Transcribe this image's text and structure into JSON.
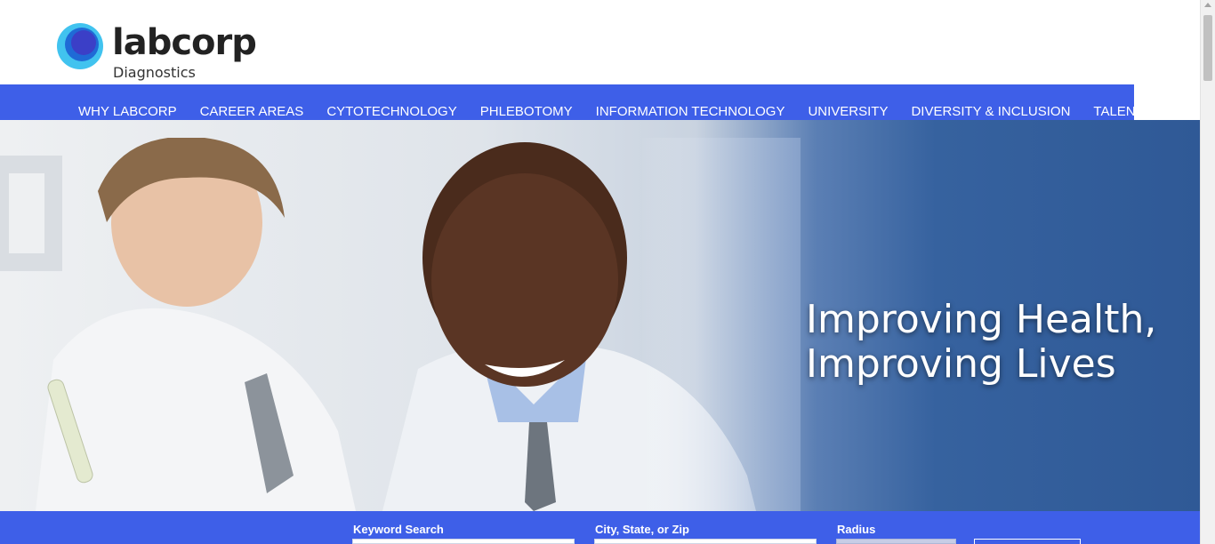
{
  "header": {
    "logo_word": "labcorp",
    "logo_sub": "Diagnostics",
    "logo_icon": "labcorp-logo-icon",
    "brand_color": "#3e5fe8"
  },
  "nav": {
    "items": [
      "WHY LABCORP",
      "CAREER AREAS",
      "CYTOTECHNOLOGY",
      "PHLEBOTOMY",
      "INFORMATION TECHNOLOGY",
      "UNIVERSITY",
      "DIVERSITY & INCLUSION",
      "TALENT COMMUNITY"
    ]
  },
  "hero": {
    "title_line1": "Improving Health,",
    "title_line2": "Improving Lives"
  },
  "search": {
    "keyword_label": "Keyword Search",
    "location_label": "City, State, or Zip",
    "radius_label": "Radius"
  }
}
